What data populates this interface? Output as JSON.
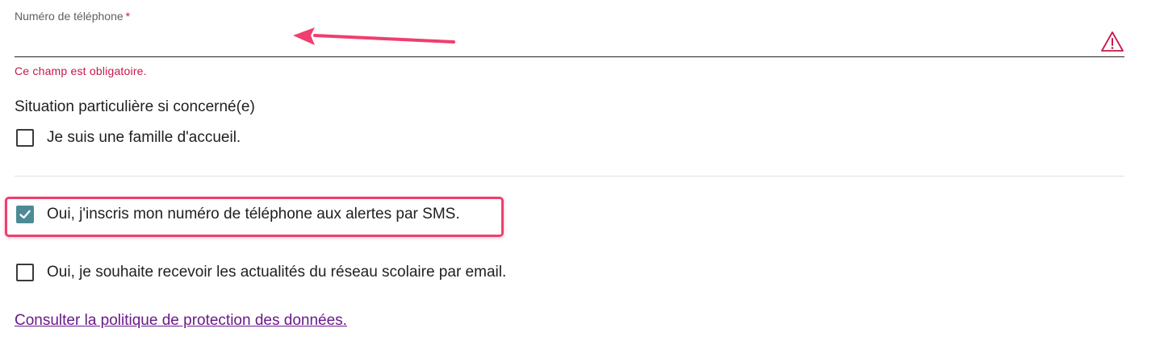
{
  "phone_field": {
    "label": "Numéro de téléphone",
    "required_mark": "*",
    "value": "",
    "error": "Ce champ est obligatoire.",
    "status_icon": "warning-triangle-icon",
    "error_color": "#c8174a"
  },
  "situation": {
    "title": "Situation particulière si concerné(e)",
    "options": [
      {
        "label": "Je suis une famille d'accueil.",
        "checked": false
      }
    ]
  },
  "subscriptions": [
    {
      "label": "Oui, j'inscris mon numéro de téléphone aux alertes par SMS.",
      "checked": true
    },
    {
      "label": "Oui, je souhaite recevoir les actualités du réseau scolaire par email.",
      "checked": false
    }
  ],
  "policy_link": {
    "label": "Consulter la politique de protection des données."
  },
  "annotations": {
    "arrow_color": "#ee3f6e",
    "highlight_color": "#ee3f6e"
  },
  "colors": {
    "checkbox_checked": "#4e8a96",
    "link": "#6a1b8a"
  }
}
